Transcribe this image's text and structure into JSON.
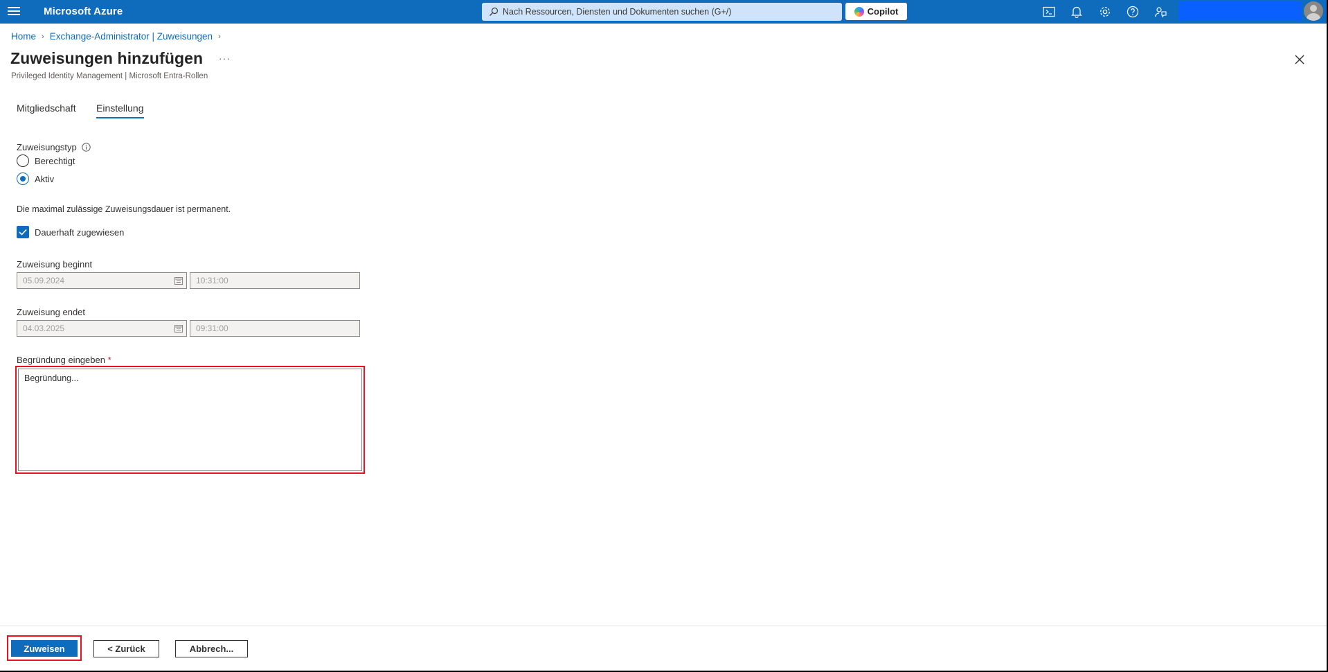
{
  "topbar": {
    "brand": "Microsoft Azure",
    "search_placeholder": "Nach Ressourcen, Diensten und Dokumenten suchen (G+/)",
    "copilot_label": "Copilot",
    "accent_color": "#0f6cbd"
  },
  "breadcrumb": {
    "items": [
      "Home",
      "Exchange-Administrator | Zuweisungen"
    ]
  },
  "page": {
    "title": "Zuweisungen hinzufügen",
    "more_label": "···",
    "subtitle": "Privileged Identity Management | Microsoft Entra-Rollen"
  },
  "tabs": [
    {
      "label": "Mitgliedschaft",
      "active": false
    },
    {
      "label": "Einstellung",
      "active": true
    }
  ],
  "form": {
    "assignment_type_label": "Zuweisungstyp",
    "options": [
      {
        "label": "Berechtigt",
        "selected": false
      },
      {
        "label": "Aktiv",
        "selected": true
      }
    ],
    "max_duration_text": "Die maximal zulässige Zuweisungsdauer ist permanent.",
    "permanent_label": "Dauerhaft zugewiesen",
    "permanent_checked": true,
    "start_label": "Zuweisung beginnt",
    "start_date": "05.09.2024",
    "start_time": "10:31:00",
    "end_label": "Zuweisung endet",
    "end_date": "04.03.2025",
    "end_time": "09:31:00",
    "justification_label": "Begründung eingeben",
    "required_marker": "*",
    "justification_placeholder": "Begründung..."
  },
  "footer": {
    "assign_label": "Zuweisen",
    "back_label": "< Zurück",
    "cancel_label": "Abbrech..."
  },
  "highlight_color": "#e81123"
}
